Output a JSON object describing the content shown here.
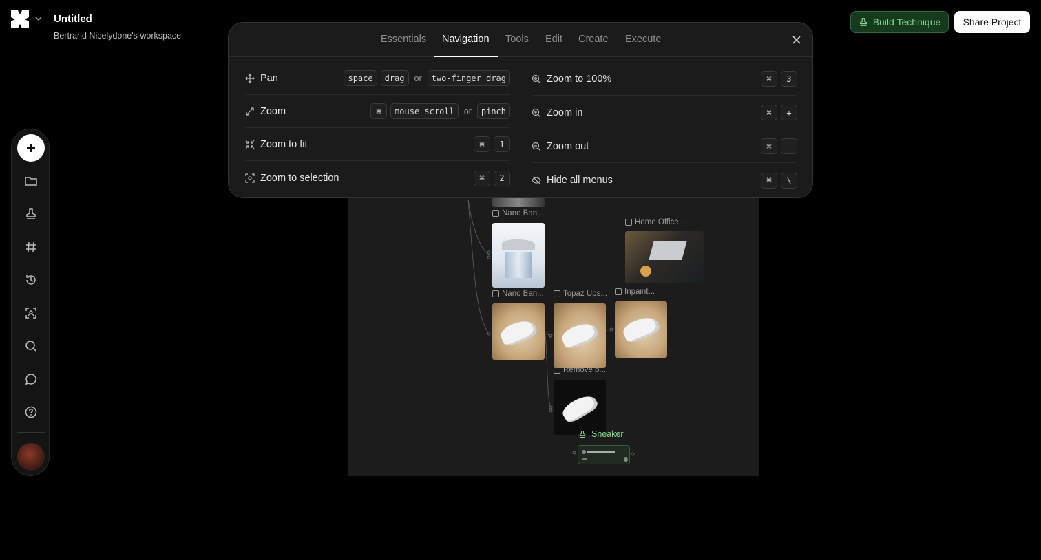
{
  "app": {
    "title": "Untitled",
    "workspace": "Bertrand Nicelydone's workspace",
    "icons": {
      "logo": "brand-logo-icon",
      "caret": "chevron-down-icon"
    }
  },
  "header": {
    "build_label": "Build Technique",
    "share_label": "Share Project",
    "accent_green": "#7fd88f"
  },
  "toolbar": {
    "items": [
      "plus-icon",
      "folder-icon",
      "stamp-icon",
      "hash-icon",
      "history-icon",
      "scan-icon",
      "search-icon",
      "chat-icon",
      "help-icon"
    ]
  },
  "shortcuts": {
    "tabs": [
      "Essentials",
      "Navigation",
      "Tools",
      "Edit",
      "Create",
      "Execute"
    ],
    "active_tab": "Navigation",
    "or": "or",
    "left": [
      {
        "label": "Pan",
        "icon": "move-icon",
        "keys": [
          "space",
          "drag"
        ],
        "alt": [
          "two-finger drag"
        ]
      },
      {
        "label": "Zoom",
        "icon": "expand-icon",
        "keys": [
          "⌘",
          "mouse scroll"
        ],
        "alt": [
          "pinch"
        ]
      },
      {
        "label": "Zoom to fit",
        "icon": "shrink-icon",
        "keys": [
          "⌘",
          "1"
        ]
      },
      {
        "label": "Zoom to selection",
        "icon": "focus-icon",
        "keys": [
          "⌘",
          "2"
        ]
      }
    ],
    "right": [
      {
        "label": "Zoom to 100%",
        "icon": "zoom-icon",
        "keys": [
          "⌘",
          "3"
        ]
      },
      {
        "label": "Zoom in",
        "icon": "zoom-in-icon",
        "keys": [
          "⌘",
          "+"
        ]
      },
      {
        "label": "Zoom out",
        "icon": "zoom-out-icon",
        "keys": [
          "⌘",
          "-"
        ]
      },
      {
        "label": "Hide all menus",
        "icon": "eye-off-icon",
        "keys": [
          "⌘",
          "\\"
        ]
      }
    ]
  },
  "canvas": {
    "nodes": [
      "Nano Ban...",
      "Home Office ...",
      "Nano Ban...",
      "Topaz Ups...",
      "Inpaint...",
      "Remove b..."
    ],
    "technique": "Sneaker"
  }
}
